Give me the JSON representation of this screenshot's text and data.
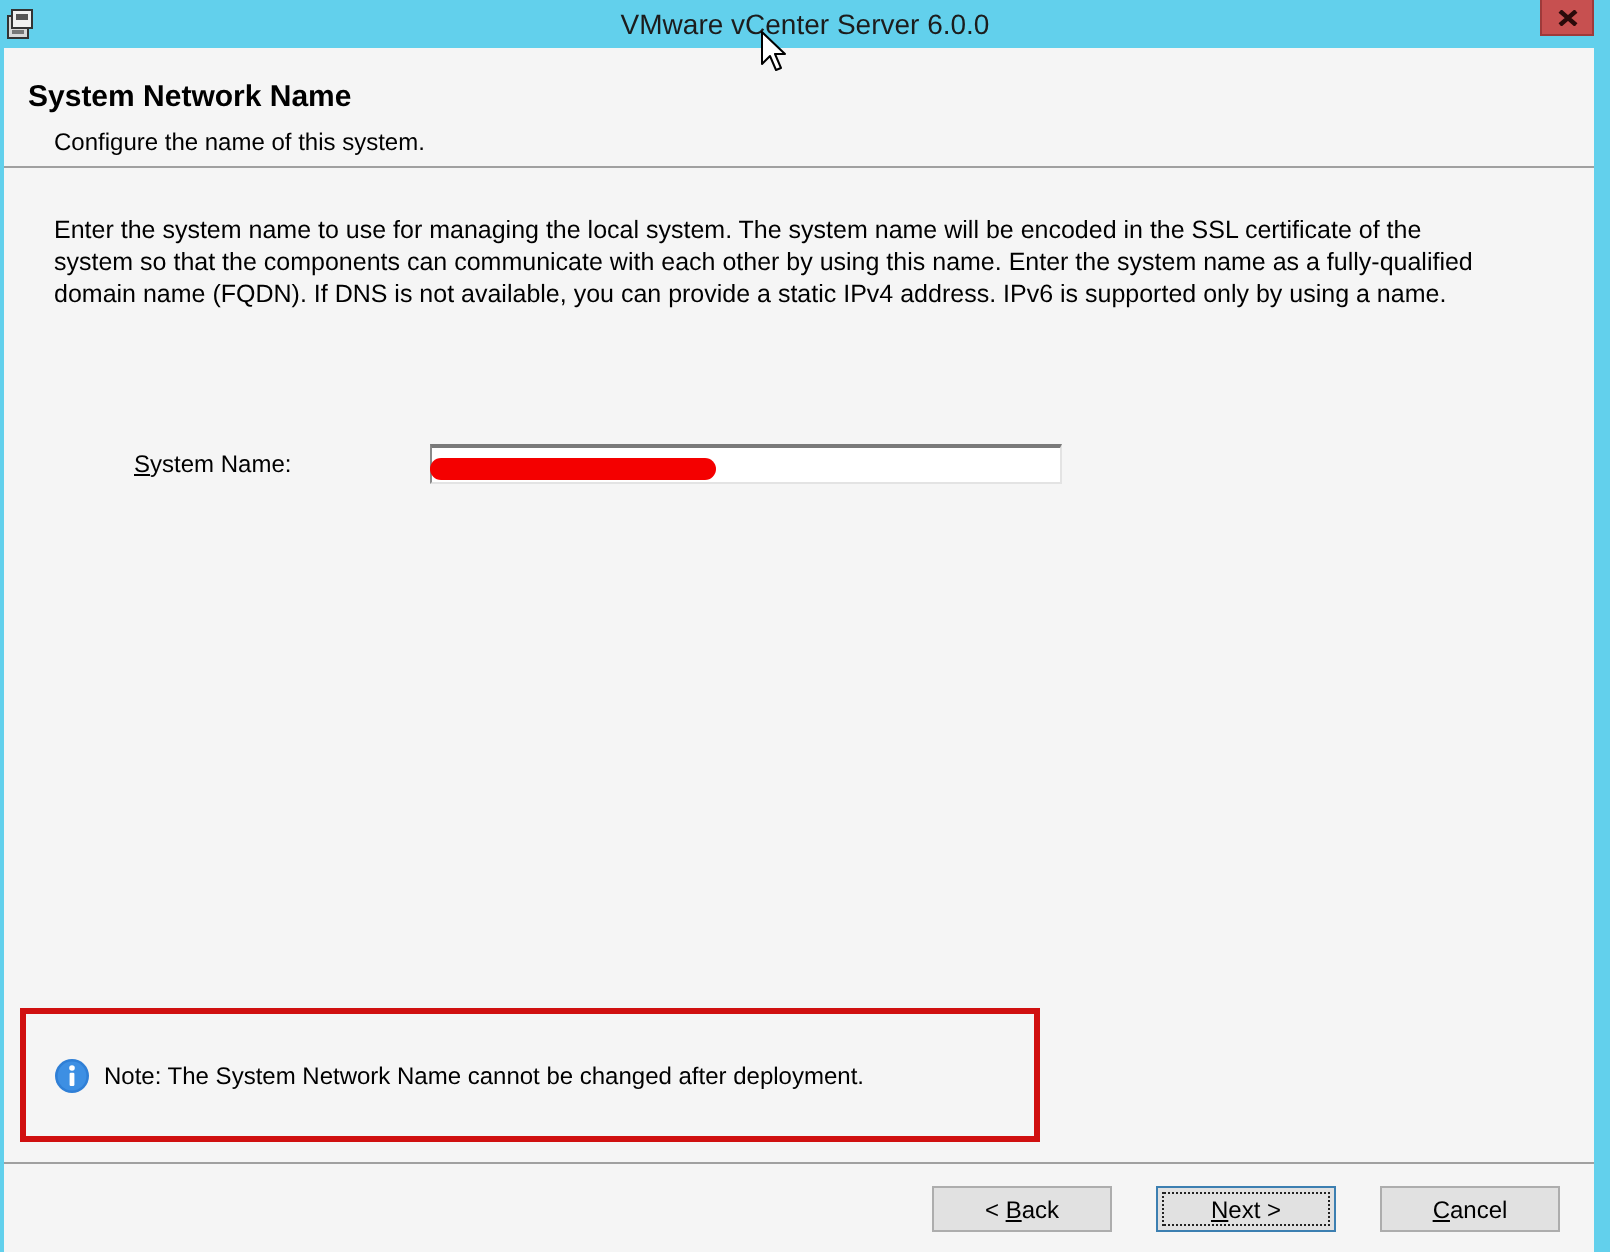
{
  "window": {
    "title": "VMware vCenter Server 6.0.0"
  },
  "header": {
    "title": "System Network Name",
    "subtitle": "Configure the name of this system."
  },
  "description": "Enter the system name to use for managing the local system. The system name will be encoded in the SSL certificate of the system so that the components can communicate with each other by using this name. Enter the system name as a fully-qualified domain name (FQDN). If DNS is not available, you can provide a static IPv4 address. IPv6 is supported only by using a name.",
  "system_name": {
    "label": "System Name:",
    "access_key_underlined": true,
    "redacted": true
  },
  "note": {
    "text": "Note: The System Network Name cannot be changed after deployment.",
    "outlined": true
  },
  "buttons": [
    {
      "label": "< Back",
      "access_key_underlined": true,
      "focused": false
    },
    {
      "label": "Next >",
      "access_key_underlined": true,
      "focused": true
    },
    {
      "label": "Cancel",
      "access_key_underlined": true,
      "focused": false
    }
  ]
}
